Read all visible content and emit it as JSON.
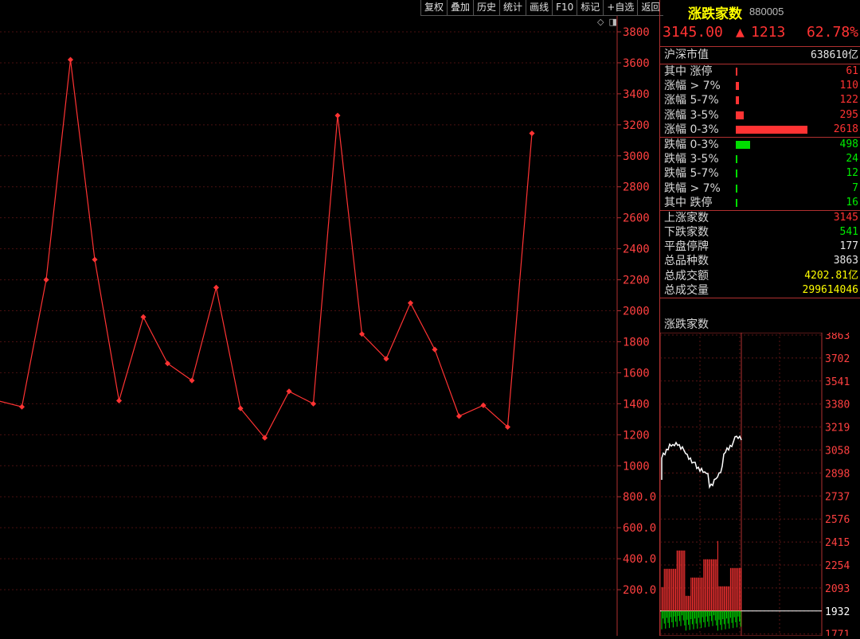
{
  "toolbar": [
    "复权",
    "叠加",
    "历史",
    "统计",
    "画线",
    "F10",
    "标记",
    "+自选",
    "返回"
  ],
  "header": {
    "title": "涨跌家数",
    "code": "880005",
    "price": "3145.00",
    "change_arrow": "▲",
    "change": "1213",
    "change_pct": "62.78%"
  },
  "market_cap": {
    "label": "沪深市值",
    "value": "638610亿"
  },
  "rise_rows": [
    {
      "label": "其中 涨停",
      "value": "61",
      "bar": 0.012
    },
    {
      "label": "涨幅 > 7%",
      "value": "110",
      "bar": 0.02
    },
    {
      "label": "涨幅 5-7%",
      "value": "122",
      "bar": 0.022
    },
    {
      "label": "涨幅 3-5%",
      "value": "295",
      "bar": 0.05
    },
    {
      "label": "涨幅 0-3%",
      "value": "2618",
      "bar": 0.45
    }
  ],
  "fall_rows": [
    {
      "label": "跌幅 0-3%",
      "value": "498",
      "bar": 0.09
    },
    {
      "label": "跌幅 3-5%",
      "value": "24",
      "bar": 0.004
    },
    {
      "label": "跌幅 5-7%",
      "value": "12",
      "bar": 0.002
    },
    {
      "label": "跌幅 > 7%",
      "value": "7",
      "bar": 0.001
    },
    {
      "label": "其中 跌停",
      "value": "16",
      "bar": 0.003
    }
  ],
  "summary_rows": [
    {
      "label": "上涨家数",
      "value": "3145",
      "color": "red"
    },
    {
      "label": "下跌家数",
      "value": "541",
      "color": "green"
    },
    {
      "label": "平盘停牌",
      "value": "177",
      "color": "white"
    },
    {
      "label": "总品种数",
      "value": "3863",
      "color": "white"
    },
    {
      "label": "总成交额",
      "value": "4202.81亿",
      "color": "yellow"
    },
    {
      "label": "总成交量",
      "value": "299614046",
      "color": "yellow"
    }
  ],
  "mini_chart": {
    "title": "涨跌家数",
    "y_ticks": [
      "3863",
      "3702",
      "3541",
      "3380",
      "3219",
      "3058",
      "2898",
      "2737",
      "2576",
      "2415",
      "2254",
      "2093",
      "1932",
      "1771"
    ],
    "baseline_label": "1932",
    "line_color": "#ffffff"
  },
  "chart_data": {
    "type": "line",
    "y_ticks": [
      "3800",
      "3600",
      "3400",
      "3200",
      "3000",
      "2800",
      "2600",
      "2400",
      "2200",
      "2000",
      "1800",
      "1600",
      "1400",
      "1200",
      "1000",
      "800.0",
      "600.0",
      "400.0",
      "200.0"
    ],
    "ylim": [
      0,
      3900
    ],
    "values": [
      1420,
      1380,
      2200,
      3620,
      2330,
      1420,
      1960,
      1660,
      1550,
      2150,
      1370,
      1180,
      1480,
      1400,
      3260,
      1850,
      1690,
      2050,
      1750,
      1320,
      1390,
      1250,
      3145
    ],
    "line_color": "#ff3333",
    "grid": true
  }
}
